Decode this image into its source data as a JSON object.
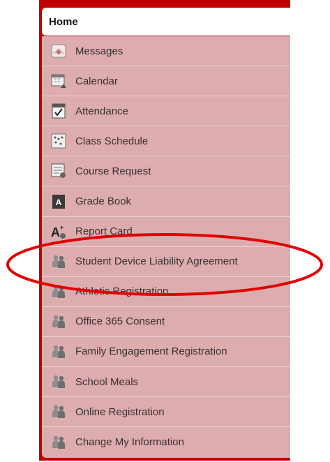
{
  "header": {
    "title": "Home"
  },
  "menu": {
    "items": [
      {
        "label": "Messages",
        "icon": "messages-icon"
      },
      {
        "label": "Calendar",
        "icon": "calendar-icon"
      },
      {
        "label": "Attendance",
        "icon": "attendance-icon"
      },
      {
        "label": "Class Schedule",
        "icon": "class-schedule-icon"
      },
      {
        "label": "Course Request",
        "icon": "course-request-icon"
      },
      {
        "label": "Grade Book",
        "icon": "grade-book-icon"
      },
      {
        "label": "Report Card",
        "icon": "report-card-icon"
      },
      {
        "label": "Student Device Liability Agreement",
        "icon": "people-icon"
      },
      {
        "label": "Athletic Registration",
        "icon": "people-icon"
      },
      {
        "label": "Office 365 Consent",
        "icon": "people-icon"
      },
      {
        "label": "Family Engagement Registration",
        "icon": "people-icon"
      },
      {
        "label": "School Meals",
        "icon": "people-icon"
      },
      {
        "label": "Online Registration",
        "icon": "people-icon"
      },
      {
        "label": "Change My Information",
        "icon": "people-icon"
      }
    ]
  },
  "annotation": {
    "highlighted_item": "Student Device Liability Agreement",
    "color": "#e00000"
  },
  "colors": {
    "panel": "#c20000",
    "menu_bg": "#dcacae",
    "text": "#3c2f31"
  }
}
